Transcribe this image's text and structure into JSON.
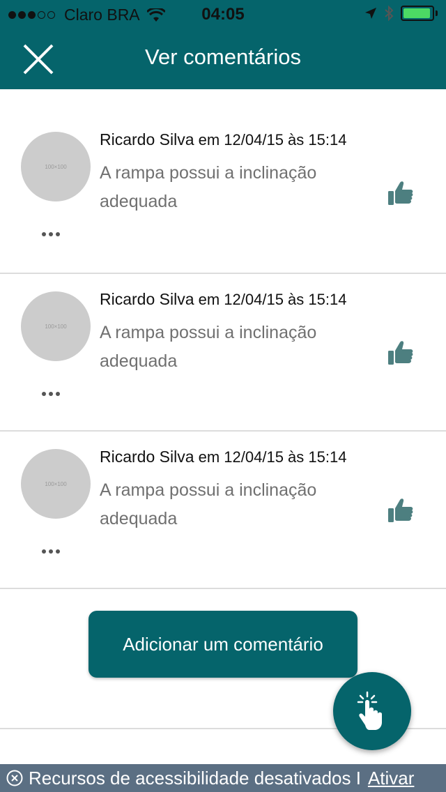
{
  "status_bar": {
    "carrier": "Claro BRA",
    "time": "04:05",
    "signal_icon": "signal-dots-icon",
    "wifi_icon": "wifi-icon",
    "location_icon": "location-arrow-icon",
    "bluetooth_icon": "bluetooth-icon",
    "battery_color": "#4cd964"
  },
  "header": {
    "title": "Ver comentários",
    "close_icon": "close-icon",
    "background": "#05646b"
  },
  "comments": [
    {
      "avatar_placeholder": "100×100",
      "author": "Ricardo Silva",
      "meta": "em 12/04/15 às 15:14",
      "text": "A rampa possui a inclinação adequada",
      "like_icon": "thumbs-up-icon",
      "more_icon": "more-dots-icon"
    },
    {
      "avatar_placeholder": "100×100",
      "author": "Ricardo Silva",
      "meta": "em 12/04/15 às 15:14",
      "text": "A rampa possui a inclinação adequada",
      "like_icon": "thumbs-up-icon",
      "more_icon": "more-dots-icon"
    },
    {
      "avatar_placeholder": "100×100",
      "author": "Ricardo Silva",
      "meta": "em 12/04/15 às 15:14",
      "text": "A rampa possui a inclinação adequada",
      "like_icon": "thumbs-up-icon",
      "more_icon": "more-dots-icon"
    }
  ],
  "add_comment": {
    "label": "Adicionar um comentário"
  },
  "fab": {
    "icon": "touch-hand-icon"
  },
  "accessibility_bar": {
    "text": "Recursos de acessibilidade desativados I",
    "link": "Ativar",
    "close_icon": "close-circle-icon"
  }
}
